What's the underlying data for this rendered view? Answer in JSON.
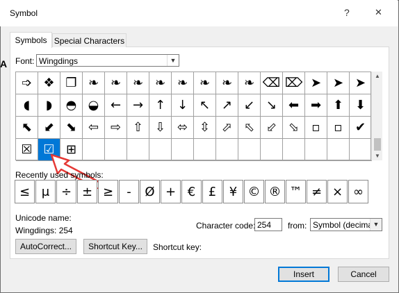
{
  "window": {
    "title": "Symbol",
    "help": "?",
    "close": "✕"
  },
  "background_text": "A",
  "tabs": [
    {
      "label": "Symbols"
    },
    {
      "label": "Special Characters"
    }
  ],
  "font": {
    "label": "Font:",
    "value": "Wingdings"
  },
  "symbol_grid": {
    "rows": [
      [
        "➩",
        "❖",
        "❐",
        "❧",
        "❧",
        "❧",
        "❧",
        "❧",
        "❧",
        "❧",
        "❧",
        "⌫",
        "⌦",
        "➤",
        "➤",
        "➤"
      ],
      [
        "◖",
        "◗",
        "◓",
        "◒",
        "←",
        "→",
        "↑",
        "↓",
        "↖",
        "↗",
        "↙",
        "↘",
        "⬅",
        "➡",
        "⬆",
        "⬇"
      ],
      [
        "⬉",
        "⬋",
        "⬊",
        "⇦",
        "⇨",
        "⇧",
        "⇩",
        "⬄",
        "⇳",
        "⬀",
        "⬁",
        "⬃",
        "⬂",
        "▫",
        "▫",
        "✖"
      ],
      [
        "☒",
        "☑",
        "⊞",
        "",
        "",
        "",
        "",
        "",
        "",
        "",
        "",
        "",
        "",
        "",
        "",
        ""
      ]
    ],
    "row3_last": "✔",
    "selected": "☑"
  },
  "recent": {
    "label": "Recently used symbols:",
    "symbols": [
      "≤",
      "μ",
      "÷",
      "±",
      "≥",
      "-",
      "Ø",
      "+",
      "€",
      "£",
      "¥",
      "©",
      "®",
      "™",
      "≠",
      "×",
      "∞"
    ]
  },
  "unicode_name": {
    "label": "Unicode name:",
    "value": "Wingdings: 254"
  },
  "character_code": {
    "label": "Character code:",
    "value": "254"
  },
  "from": {
    "label": "from:",
    "value": "Symbol (decimal)"
  },
  "buttons": {
    "autocorrect": "AutoCorrect...",
    "shortcut_key": "Shortcut Key...",
    "insert": "Insert",
    "cancel": "Cancel"
  },
  "shortcut_key_label": "Shortcut key:",
  "annotation": {
    "arrow_color": "#e53935"
  }
}
